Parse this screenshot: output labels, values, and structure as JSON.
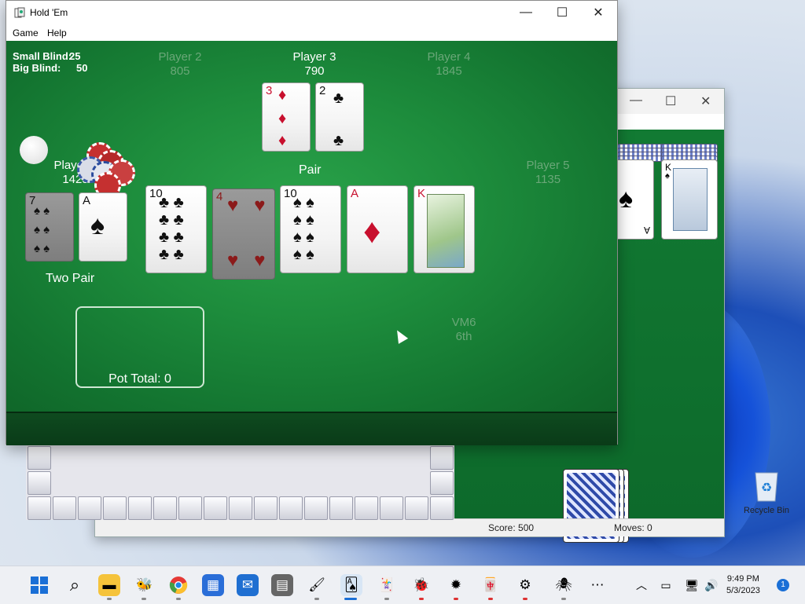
{
  "holdem": {
    "title": "Hold 'Em",
    "menu": [
      "Game",
      "Help"
    ],
    "small_blind_label": "Small Blind:",
    "small_blind_value": "25",
    "big_blind_label": "Big Blind:",
    "big_blind_value": "50",
    "players": [
      {
        "name": "Player 1",
        "chips": "1425",
        "status": "active",
        "hand_label": "Two Pair"
      },
      {
        "name": "Player 2",
        "chips": "805",
        "status": "dim"
      },
      {
        "name": "Player 3",
        "chips": "790",
        "status": "active",
        "hand_label": "Pair"
      },
      {
        "name": "Player 4",
        "chips": "1845",
        "status": "dim"
      },
      {
        "name": "Player 5",
        "chips": "1135",
        "status": "dim"
      },
      {
        "name": "VM6",
        "chips": "6th",
        "status": "dim"
      }
    ],
    "player1_cards": [
      {
        "rank": "7",
        "suit": "♠",
        "color": "black",
        "faded": true
      },
      {
        "rank": "A",
        "suit": "♠",
        "color": "black",
        "faded": false
      }
    ],
    "player3_cards": [
      {
        "rank": "3",
        "suit": "♦",
        "color": "red"
      },
      {
        "rank": "2",
        "suit": "♣",
        "color": "black"
      }
    ],
    "community_cards": [
      {
        "rank": "10",
        "suit": "♣",
        "color": "black",
        "faded": false
      },
      {
        "rank": "4",
        "suit": "♥",
        "color": "red",
        "faded": true
      },
      {
        "rank": "10",
        "suit": "♠",
        "color": "black",
        "faded": false
      },
      {
        "rank": "A",
        "suit": "♦",
        "color": "red",
        "faded": false
      },
      {
        "rank": "K",
        "suit": "♦",
        "color": "red",
        "faded": false
      }
    ],
    "pot_total": "Pot Total: 0"
  },
  "solitaire": {
    "score": "Score: 500",
    "moves": "Moves: 0",
    "visible_cards": [
      {
        "rank": "A",
        "suit": "♠"
      },
      {
        "rank": "K",
        "suit": "♠"
      }
    ]
  },
  "desktop": {
    "recycle_bin_label": "Recycle Bin"
  },
  "taskbar": {
    "time": "9:49 PM",
    "date": "5/3/2023",
    "notification_count": "1"
  }
}
